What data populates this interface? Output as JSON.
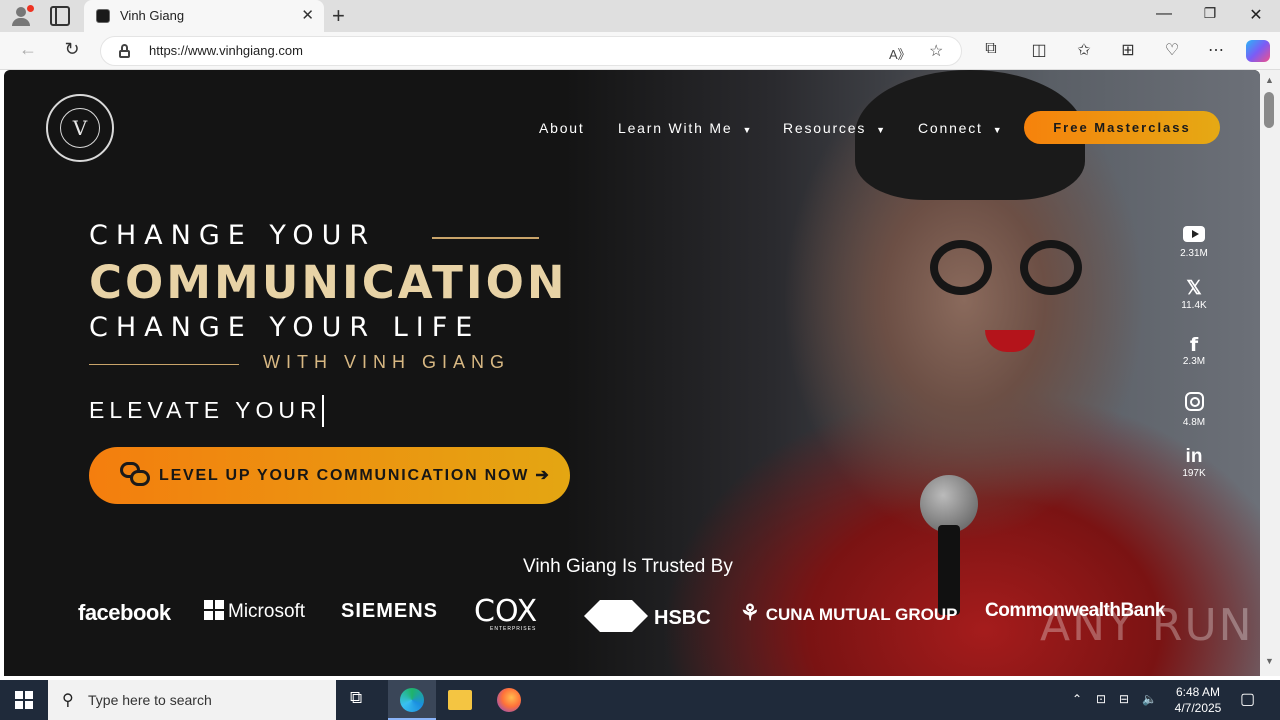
{
  "browser": {
    "tab_title": "Vinh Giang",
    "url": "https://www.vinhgiang.com",
    "new_tab": "+",
    "close_tab": "✕",
    "minimize": "—",
    "restore": "❐",
    "close_window": "✕"
  },
  "site": {
    "nav": {
      "about": "About",
      "learn": "Learn With Me",
      "resources": "Resources",
      "connect": "Connect",
      "cta": "Free Masterclass"
    },
    "hero": {
      "line1": "CHANGE YOUR",
      "line2": "COMMUNICATION",
      "line3": "CHANGE YOUR LIFE",
      "with": "WITH VINH GIANG",
      "elevate": "ELEVATE YOUR",
      "cta": "LEVEL UP YOUR COMMUNICATION NOW ➔"
    },
    "social": [
      {
        "icon": "youtube-icon",
        "count": "2.31M"
      },
      {
        "icon": "x-icon",
        "count": "11.4K"
      },
      {
        "icon": "facebook-icon",
        "count": "2.3M"
      },
      {
        "icon": "instagram-icon",
        "count": "4.8M"
      },
      {
        "icon": "linkedin-icon",
        "count": "197K"
      }
    ],
    "trusted_title": "Vinh Giang Is Trusted By",
    "brands": [
      "facebook",
      "Microsoft",
      "SIEMENS",
      "COX",
      "HSBC",
      "CUNA MUTUAL GROUP",
      "CommonwealthBank"
    ],
    "cox_sub": "ENTERPRISES",
    "colors": {
      "accent_orange": "#f47e0e",
      "accent_gold": "#e5a914",
      "headline_gold": "#e8d3a6",
      "background": "#141414"
    }
  },
  "watermark": "ANY RUN",
  "taskbar": {
    "search_placeholder": "Type here to search",
    "time": "6:48 AM",
    "date": "4/7/2025"
  }
}
